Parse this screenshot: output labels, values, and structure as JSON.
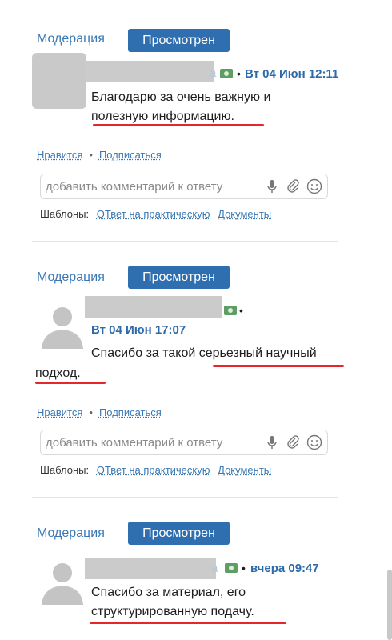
{
  "moderation_label": "Модерация",
  "status_badge": "Просмотрен",
  "like_label": "Нравится",
  "separator": "•",
  "subscribe_label": "Подписаться",
  "comment_placeholder": "добавить комментарий к ответу",
  "templates_label": "Шаблоны:",
  "template_1": "ОТвет на практическую",
  "template_2": "Документы",
  "comments": [
    {
      "date": "Вт 04 Июн 12:11",
      "line1": "Благодарю за очень важную и",
      "line2": "полезную информацию."
    },
    {
      "date": "Вт 04 Июн 17:07",
      "line1": "Спасибо за такой серьезный научный",
      "line2": "подход."
    },
    {
      "date": "вчера 09:47",
      "line1": "Спасибо за материал, его",
      "line2": "структурированную подачу."
    }
  ],
  "icons": [
    "mic-icon",
    "paperclip-icon",
    "smiley-icon",
    "money-icon",
    "user-avatar-icon"
  ],
  "colors": {
    "link": "#3a78b5",
    "badge": "#2f6fb0",
    "highlight": "#e6262a"
  }
}
